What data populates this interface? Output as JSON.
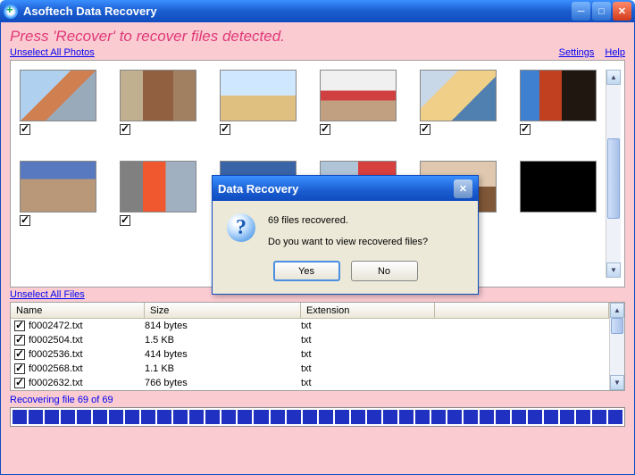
{
  "titlebar": {
    "title": "Asoftech Data Recovery"
  },
  "instruction": "Press 'Recover' to recover files detected.",
  "links": {
    "unselect_photos": "Unselect All Photos",
    "unselect_files": "Unselect All Files",
    "settings": "Settings",
    "help": "Help"
  },
  "table": {
    "headers": {
      "name": "Name",
      "size": "Size",
      "ext": "Extension"
    },
    "rows": [
      {
        "name": "f0002472.txt",
        "size": "814 bytes",
        "ext": "txt"
      },
      {
        "name": "f0002504.txt",
        "size": "1.5 KB",
        "ext": "txt"
      },
      {
        "name": "f0002536.txt",
        "size": "414 bytes",
        "ext": "txt"
      },
      {
        "name": "f0002568.txt",
        "size": "1.1 KB",
        "ext": "txt"
      },
      {
        "name": "f0002632.txt",
        "size": "766 bytes",
        "ext": "txt"
      }
    ]
  },
  "status": "Recovering file 69 of 69",
  "dialog": {
    "title": "Data Recovery",
    "line1": "69 files recovered.",
    "line2": "Do you want to view recovered files?",
    "yes": "Yes",
    "no": "No"
  }
}
